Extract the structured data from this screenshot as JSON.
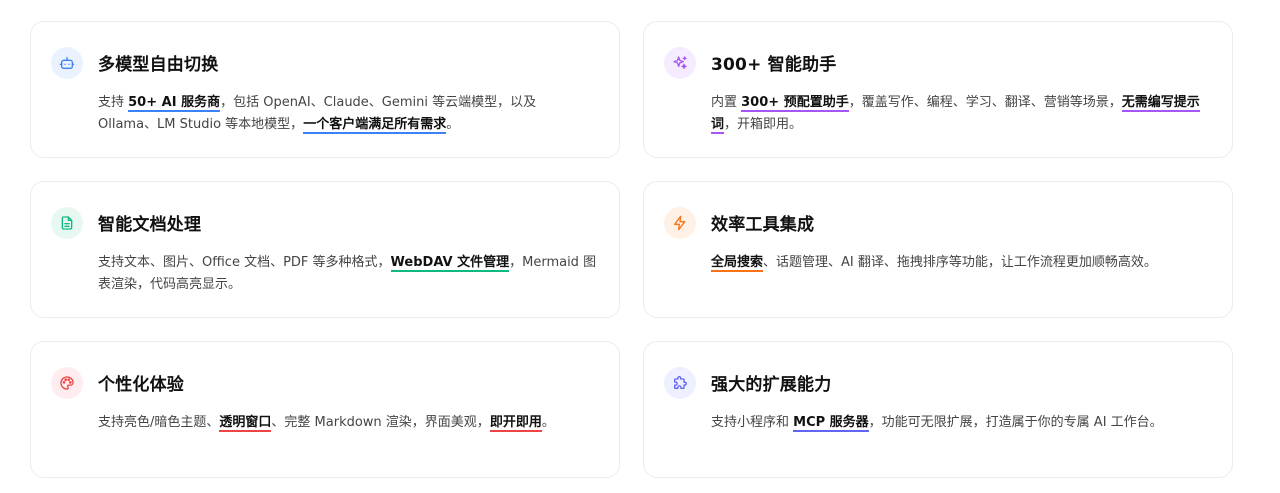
{
  "cards": [
    {
      "title": "多模型自由切换",
      "icon": "robot-icon",
      "accent": "#3b82f6",
      "icon_bg": "#eaf2ff",
      "desc": [
        {
          "t": "支持 "
        },
        {
          "t": "50+ AI 服务商",
          "hl": true
        },
        {
          "t": "，包括 OpenAI、Claude、Gemini 等云端模型，以及 Ollama、LM Studio 等本地模型，"
        },
        {
          "t": "一个客户端满足所有需求",
          "hl": true
        },
        {
          "t": "。"
        }
      ]
    },
    {
      "title": "300+ 智能助手",
      "icon": "sparkles-icon",
      "accent": "#a855f7",
      "icon_bg": "#f5edff",
      "desc": [
        {
          "t": "内置 "
        },
        {
          "t": "300+ 预配置助手",
          "hl": true
        },
        {
          "t": "，覆盖写作、编程、学习、翻译、营销等场景，"
        },
        {
          "t": "无需编写提示词",
          "hl": true
        },
        {
          "t": "，开箱即用。"
        }
      ]
    },
    {
      "title": "智能文档处理",
      "icon": "document-icon",
      "accent": "#10b981",
      "icon_bg": "#e7f8f1",
      "desc": [
        {
          "t": "支持文本、图片、Office 文档、PDF 等多种格式，"
        },
        {
          "t": "WebDAV 文件管理",
          "hl": true
        },
        {
          "t": "，Mermaid 图表渲染，代码高亮显示。"
        }
      ]
    },
    {
      "title": "效率工具集成",
      "icon": "lightning-icon",
      "accent": "#f97316",
      "icon_bg": "#fff1e6",
      "desc": [
        {
          "t": "全局搜索",
          "hl": true
        },
        {
          "t": "、话题管理、AI 翻译、拖拽排序等功能，让工作流程更加顺畅高效。"
        }
      ]
    },
    {
      "title": "个性化体验",
      "icon": "palette-icon",
      "accent": "#ef4444",
      "icon_bg": "#ffecee",
      "desc": [
        {
          "t": "支持亮色/暗色主题、"
        },
        {
          "t": "透明窗口",
          "hl": true
        },
        {
          "t": "、完整 Markdown 渲染，界面美观，"
        },
        {
          "t": "即开即用",
          "hl": true
        },
        {
          "t": "。"
        }
      ]
    },
    {
      "title": "强大的扩展能力",
      "icon": "puzzle-icon",
      "accent": "#6366f1",
      "icon_bg": "#eef0ff",
      "desc": [
        {
          "t": "支持小程序和 "
        },
        {
          "t": "MCP 服务器",
          "hl": true
        },
        {
          "t": "，功能可无限扩展，打造属于你的专属 AI 工作台。"
        }
      ]
    }
  ]
}
